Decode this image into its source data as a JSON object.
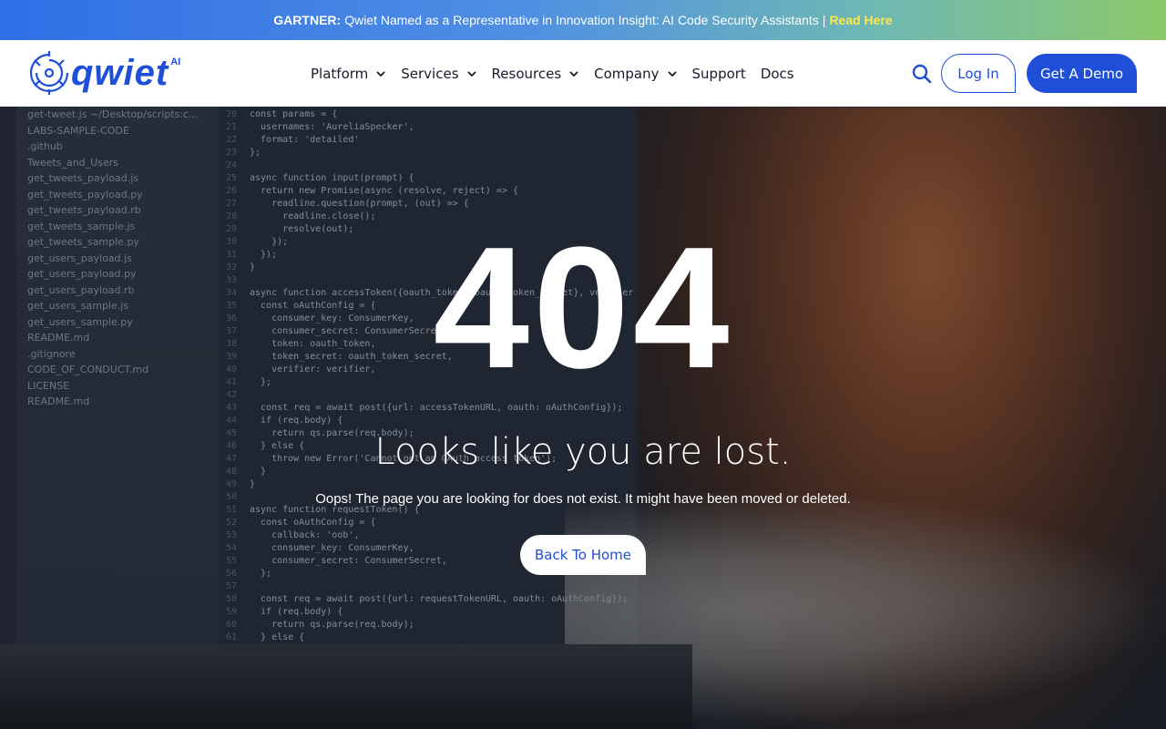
{
  "banner": {
    "prefix": "GARTNER:",
    "message": "Qwiet Named as a Representative in Innovation Insight: AI Code Security Assistants",
    "separator": "|",
    "link": "Read Here"
  },
  "header": {
    "logo_text": "qwiet",
    "logo_suffix": "AI",
    "nav": [
      {
        "label": "Platform",
        "has_dropdown": true
      },
      {
        "label": "Services",
        "has_dropdown": true
      },
      {
        "label": "Resources",
        "has_dropdown": true
      },
      {
        "label": "Company",
        "has_dropdown": true
      },
      {
        "label": "Support",
        "has_dropdown": false
      },
      {
        "label": "Docs",
        "has_dropdown": false
      }
    ],
    "search_icon": "search-icon",
    "login_label": "Log In",
    "demo_label": "Get A Demo"
  },
  "hero": {
    "code": "404",
    "headline": "Looks like you are lost.",
    "message": "Oops! The page you are looking for does not exist. It might have been moved or deleted.",
    "button_label": "Back To Home"
  },
  "background_editor": {
    "files": [
      "get-tweet.js ~/Desktop/scripts:c...",
      "LABS-SAMPLE-CODE",
      ".github",
      "Tweets_and_Users",
      "get_tweets_payload.js",
      "get_tweets_payload.py",
      "get_tweets_payload.rb",
      "get_tweets_sample.js",
      "get_tweets_sample.py",
      "get_users_payload.js",
      "get_users_payload.py",
      "get_users_payload.rb",
      "get_users_sample.js",
      "get_users_sample.py",
      "README.md",
      ".gitignore",
      "CODE_OF_CONDUCT.md",
      "LICENSE",
      "README.md"
    ],
    "code_lines": [
      {
        "n": "20",
        "t": "const params = {"
      },
      {
        "n": "21",
        "t": "  usernames: 'AureliaSpecker',"
      },
      {
        "n": "22",
        "t": "  format: 'detailed'"
      },
      {
        "n": "23",
        "t": "};"
      },
      {
        "n": "24",
        "t": ""
      },
      {
        "n": "25",
        "t": "async function input(prompt) {"
      },
      {
        "n": "26",
        "t": "  return new Promise(async (resolve, reject) => {"
      },
      {
        "n": "27",
        "t": "    readline.question(prompt, (out) => {"
      },
      {
        "n": "28",
        "t": "      readline.close();"
      },
      {
        "n": "29",
        "t": "      resolve(out);"
      },
      {
        "n": "30",
        "t": "    });"
      },
      {
        "n": "31",
        "t": "  });"
      },
      {
        "n": "32",
        "t": "}"
      },
      {
        "n": "33",
        "t": ""
      },
      {
        "n": "34",
        "t": "async function accessToken({oauth_token, oauth_token_secret}, verifier"
      },
      {
        "n": "35",
        "t": "  const oAuthConfig = {"
      },
      {
        "n": "36",
        "t": "    consumer_key: ConsumerKey,"
      },
      {
        "n": "37",
        "t": "    consumer_secret: ConsumerSecret,"
      },
      {
        "n": "38",
        "t": "    token: oauth_token,"
      },
      {
        "n": "39",
        "t": "    token_secret: oauth_token_secret,"
      },
      {
        "n": "40",
        "t": "    verifier: verifier,"
      },
      {
        "n": "41",
        "t": "  };"
      },
      {
        "n": "42",
        "t": ""
      },
      {
        "n": "43",
        "t": "  const req = await post({url: accessTokenURL, oauth: oAuthConfig});"
      },
      {
        "n": "44",
        "t": "  if (req.body) {"
      },
      {
        "n": "45",
        "t": "    return qs.parse(req.body);"
      },
      {
        "n": "46",
        "t": "  } else {"
      },
      {
        "n": "47",
        "t": "    throw new Error('Cannot get an OAuth access token');"
      },
      {
        "n": "48",
        "t": "  }"
      },
      {
        "n": "49",
        "t": "}"
      },
      {
        "n": "50",
        "t": ""
      },
      {
        "n": "51",
        "t": "async function requestToken() {"
      },
      {
        "n": "52",
        "t": "  const oAuthConfig = {"
      },
      {
        "n": "53",
        "t": "    callback: 'oob',"
      },
      {
        "n": "54",
        "t": "    consumer_key: ConsumerKey,"
      },
      {
        "n": "55",
        "t": "    consumer_secret: ConsumerSecret,"
      },
      {
        "n": "56",
        "t": "  };"
      },
      {
        "n": "57",
        "t": ""
      },
      {
        "n": "58",
        "t": "  const req = await post({url: requestTokenURL, oauth: oAuthConfig});"
      },
      {
        "n": "59",
        "t": "  if (req.body) {"
      },
      {
        "n": "60",
        "t": "    return qs.parse(req.body);"
      },
      {
        "n": "61",
        "t": "  } else {"
      }
    ]
  },
  "colors": {
    "brand_blue": "#1f4fd8",
    "banner_link": "#ffe94a"
  }
}
